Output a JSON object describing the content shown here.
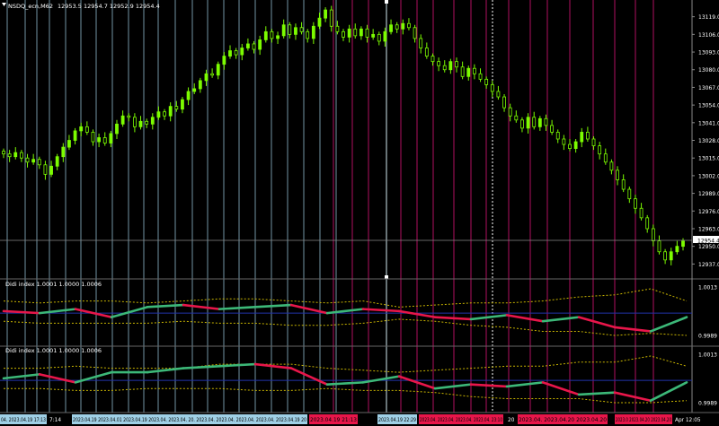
{
  "header": {
    "title": "NSDQ_ecn,M62",
    "ohlc": "12953.5 12954.7 12952.9 12954.4",
    "current_price": "12954.4"
  },
  "colors": {
    "background": "#000000",
    "candle_up": "#7CFC00",
    "candle_down": "#000000",
    "grid_blue": "#8fb8cc",
    "grid_red": "#b01060",
    "osc_up": "#3cb878",
    "osc_down": "#e8164a",
    "band": "#c8b400",
    "mid_line": "#2233aa",
    "price_line": "#888888",
    "axis_text": "#ffffff",
    "time_label_blue": "#9fd0e6",
    "time_label_red": "#e8164a"
  },
  "chart_data": [
    {
      "type": "candlestick",
      "title": "NSDQ_ecn,M62",
      "y_ticks": [
        "13119.0",
        "13106.0",
        "13093.0",
        "13080.0",
        "13067.0",
        "13054.0",
        "13041.0",
        "13028.0",
        "13015.0",
        "13002.0",
        "12989.0",
        "12976.0",
        "12963.0",
        "12950.0",
        "12937.0"
      ],
      "ylim": [
        12928,
        13130
      ],
      "close": [
        13018,
        13016,
        13019,
        13015,
        13012,
        13014,
        13010,
        13003,
        13009,
        13016,
        13023,
        13028,
        13035,
        13038,
        13034,
        13027,
        13030,
        13026,
        13033,
        13040,
        13046,
        13045,
        13038,
        13042,
        13040,
        13045,
        13049,
        13046,
        13053,
        13051,
        13058,
        13064,
        13066,
        13072,
        13077,
        13076,
        13084,
        13090,
        13094,
        13091,
        13096,
        13099,
        13095,
        13102,
        13108,
        13103,
        13105,
        13113,
        13106,
        13111,
        13108,
        13103,
        13112,
        13118,
        13124,
        13112,
        13108,
        13104,
        13110,
        13105,
        13110,
        13104,
        13106,
        13101,
        13108,
        13113,
        13110,
        13114,
        13111,
        13103,
        13096,
        13090,
        13086,
        13083,
        13080,
        13086,
        13082,
        13075,
        13081,
        13077,
        13073,
        13069,
        13064,
        13060,
        13052,
        13046,
        13043,
        13037,
        13045,
        13038,
        13044,
        13039,
        13034,
        13029,
        13025,
        13022,
        13027,
        13034,
        13029,
        13024,
        13018,
        13012,
        13006,
        12999,
        12992,
        12985,
        12978,
        12971,
        12963,
        12954,
        12946,
        12940,
        12946,
        12950,
        12954
      ]
    },
    {
      "type": "line",
      "title": "Didi index 1.0001 1.0000 1.0006",
      "y_ticks": [
        "1.0013",
        "0.9989"
      ],
      "ylim": [
        0.9985,
        1.0016
      ],
      "x": [
        0,
        6,
        12,
        18,
        24,
        30,
        36,
        42,
        48,
        54,
        60,
        66,
        72,
        78,
        84,
        90,
        96,
        102,
        108,
        114
      ],
      "series": [
        {
          "values": [
            1.0001,
            1.0,
            1.0002,
            0.9998,
            1.0003,
            1.0004,
            1.0002,
            1.0003,
            1.0004,
            1.0,
            1.0002,
            1.0001,
            0.9998,
            0.9997,
            0.9999,
            0.9996,
            0.9998,
            0.9993,
            0.9991,
            0.9998
          ]
        },
        {
          "values": [
            1.0006,
            1.0005,
            1.0006,
            1.0006,
            1.0005,
            1.0006,
            1.0007,
            1.0007,
            1.0006,
            1.0005,
            1.0006,
            1.0003,
            1.0004,
            1.0005,
            1.0005,
            1.0006,
            1.0008,
            1.0009,
            1.0012,
            1.0006
          ]
        },
        {
          "values": [
            0.9996,
            0.9995,
            0.9995,
            0.9995,
            0.9995,
            0.9996,
            0.9995,
            0.9995,
            0.9994,
            0.9994,
            0.9995,
            0.9997,
            0.9996,
            0.9994,
            0.9993,
            0.9991,
            0.9991,
            0.9989,
            0.999,
            0.9989
          ]
        }
      ]
    },
    {
      "type": "line",
      "title": "Didi index 1.0001 1.0000 1.0006",
      "y_ticks": [
        "1.0013",
        "0.9989"
      ],
      "ylim": [
        0.9985,
        1.0016
      ],
      "x": [
        0,
        6,
        12,
        18,
        24,
        30,
        36,
        42,
        48,
        54,
        60,
        66,
        72,
        78,
        84,
        90,
        96,
        102,
        108,
        114
      ],
      "series": [
        {
          "values": [
            1.0001,
            1.0003,
            0.9999,
            1.0004,
            1.0004,
            1.0006,
            1.0007,
            1.0008,
            1.0006,
            0.9998,
            0.9999,
            1.0002,
            0.9996,
            0.9998,
            0.9997,
            0.9999,
            0.9993,
            0.9994,
            0.999,
            0.9999
          ]
        },
        {
          "values": [
            1.0006,
            1.0006,
            1.0007,
            1.0006,
            1.0006,
            1.0006,
            1.0008,
            1.0008,
            1.0008,
            1.0006,
            1.0005,
            1.0004,
            1.0005,
            1.0006,
            1.0007,
            1.0007,
            1.0009,
            1.0009,
            1.0012,
            1.0007
          ]
        },
        {
          "values": [
            0.9996,
            0.9996,
            0.9995,
            0.9995,
            0.9996,
            0.9996,
            0.9996,
            0.9995,
            0.9995,
            0.9996,
            0.9995,
            0.9995,
            0.9994,
            0.9992,
            0.9991,
            0.9991,
            0.9991,
            0.9989,
            0.9989,
            0.999
          ]
        }
      ]
    }
  ],
  "time_labels": [
    {
      "text": "04. 2023.04.19 17:13",
      "tone": "blue"
    },
    {
      "text": "7:14",
      "tone": "plain"
    },
    {
      "text": "2023.04.19 2023.04.01 2023.04.19 2023.04. 2023.04. 20. 2023.04. 2023.04. 2023.04. 2023.04. 2023.04.19 20",
      "tone": "blue"
    },
    {
      "text": "2023.04.19 21:13",
      "tone": "red"
    },
    {
      "text": "2023.04.19 22:29",
      "tone": "blue"
    },
    {
      "text": "2023.04. 2023.04. 2023.04. 2023.04. 23:10",
      "tone": "red"
    },
    {
      "text": "20",
      "tone": "plain"
    },
    {
      "text": "2023.04. 2023.04.20 2023.04.20",
      "tone": "red"
    },
    {
      "text": "2023.0 2023.04.20 2023.04.20",
      "tone": "red"
    },
    {
      "text": "Apr 12:05",
      "tone": "plain"
    }
  ]
}
